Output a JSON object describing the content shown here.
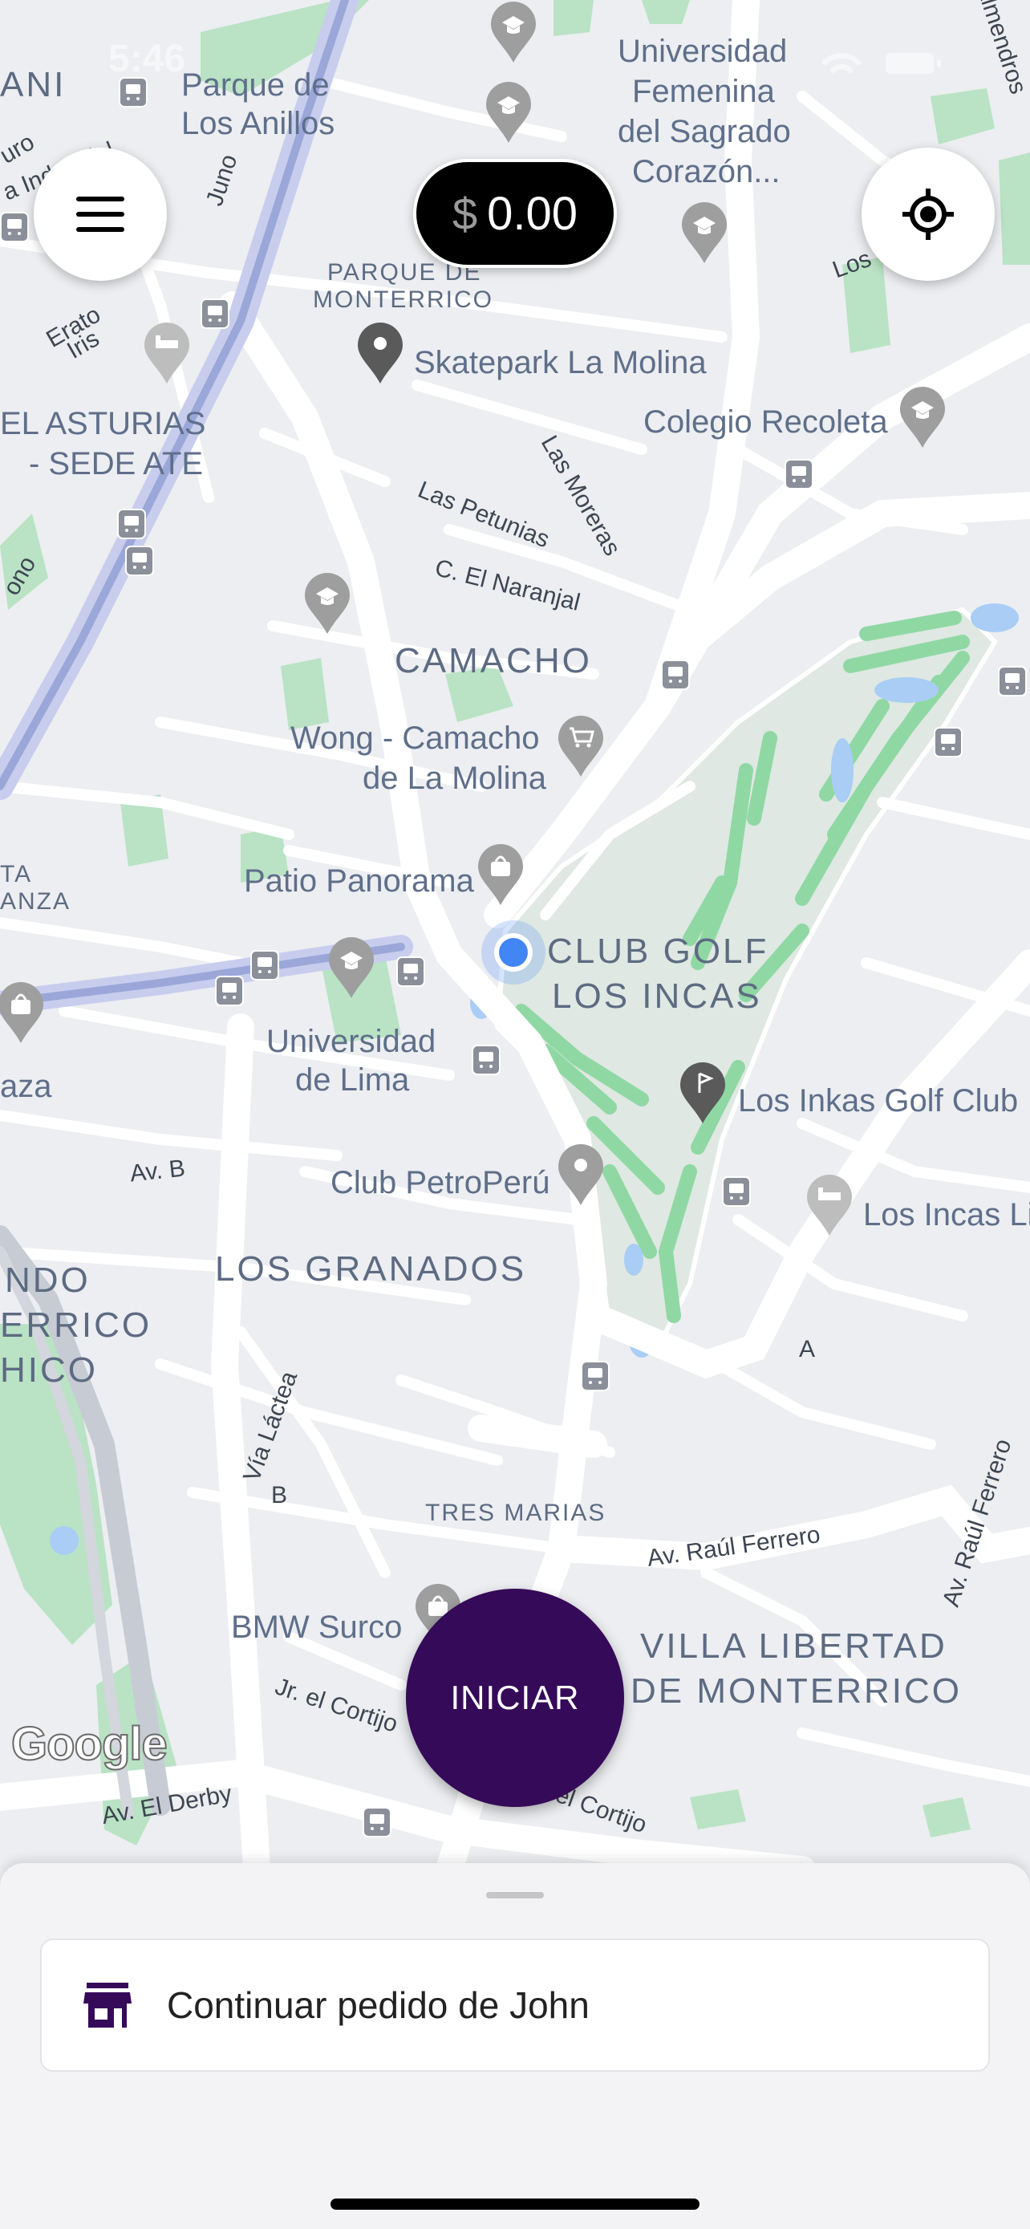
{
  "status_bar": {
    "time": "5:46"
  },
  "header": {
    "menu_icon": "hamburger-menu-icon",
    "balance": {
      "currency": "$",
      "amount": "0.00"
    },
    "locate_icon": "my-location-icon"
  },
  "map": {
    "areas": {
      "camacho": "CAMACHO",
      "club_golf_1": "CLUB GOLF",
      "club_golf_2": "LOS INCAS",
      "los_granados": "LOS GRANADOS",
      "villa_1": "VILLA LIBERTAD",
      "villa_2": "DE MONTERRICO",
      "parque_1": "PARQUE DE",
      "parque_2": "MONTERRICO",
      "tres_marias": "TRES MARIAS",
      "ani": "ANI",
      "ndo": "NDO",
      "errico": "ERRICO",
      "hico": "HICO",
      "ta": "TA",
      "anza": "ANZA"
    },
    "places": {
      "parque_anillos_1": "Parque de",
      "parque_anillos_2": "Los Anillos",
      "univ_femenina_1": "Universidad",
      "univ_femenina_2": "Femenina",
      "univ_femenina_3": "del Sagrado",
      "univ_femenina_4": "Corazón...",
      "skatepark": "Skatepark La Molina",
      "colegio": "Colegio Recoleta",
      "asturias_1": "EL ASTURIAS",
      "asturias_2": "- SEDE ATE",
      "wong_1": "Wong - Camacho",
      "wong_2": "de La Molina",
      "patio": "Patio Panorama",
      "univ_lima_1": "Universidad",
      "univ_lima_2": "de Lima",
      "inkas_golf": "Los Inkas Golf Club",
      "petroperu": "Club PetroPerú",
      "incas_li": "Los Incas Li",
      "bmw": "BMW Surco",
      "aza": "aza"
    },
    "streets": {
      "juno": "Juno",
      "erato": "Erato",
      "iris": "Iris",
      "industrial": "a Industrial",
      "las_moreras": "Las Moreras",
      "las_petunias": "Las Petunias",
      "el_naranjal": "C. El Naranjal",
      "av_b": "Av. B",
      "via_lactea": "Vía Láctea",
      "b": "B",
      "a": "A",
      "av_raul_ferrero": "Av. Raúl Ferrero",
      "av_raul_ferrero_2": "Av. Raúl Ferrero",
      "jr_cortijo": "Jr. el Cortijo",
      "el_cortijo": "el Cortijo",
      "av_el_derby": "Av. El Derby",
      "almendros": "Almendros",
      "los": "Los",
      "ono": "ono",
      "uro": "uro"
    },
    "attribution": "Google"
  },
  "start_button": {
    "label": "INICIAR"
  },
  "bottom_sheet": {
    "store_icon": "store-icon",
    "continue_label": "Continuar pedido de John"
  },
  "colors": {
    "brand_purple": "#350a58",
    "balance_bg": "#000000",
    "user_location": "#4285f4",
    "map_bg": "#eceef1",
    "park_green": "#a8ddb5",
    "highway": "#9aa7d8"
  }
}
